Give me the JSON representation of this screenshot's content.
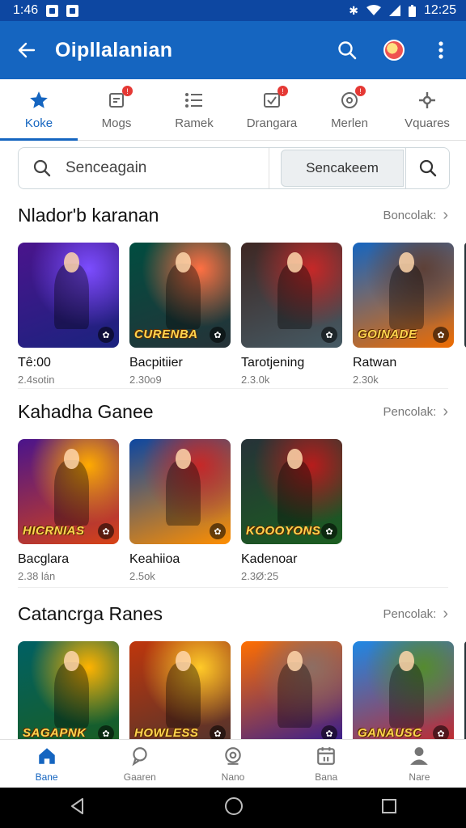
{
  "status": {
    "time": "1:46",
    "right_time": "12:25"
  },
  "app": {
    "title": "Oipllalanian"
  },
  "tabs": [
    {
      "label": "Koke",
      "icon": "star-icon",
      "active": true,
      "badge": false
    },
    {
      "label": "Mogs",
      "icon": "note-icon",
      "active": false,
      "badge": true
    },
    {
      "label": "Ramek",
      "icon": "list-icon",
      "active": false,
      "badge": false
    },
    {
      "label": "Drangara",
      "icon": "checkbox-icon",
      "active": false,
      "badge": true
    },
    {
      "label": "Merlen",
      "icon": "gamepad-icon",
      "active": false,
      "badge": true
    },
    {
      "label": "Vquares",
      "icon": "compass-icon",
      "active": false,
      "badge": false
    }
  ],
  "search": {
    "placeholder": "Senceagain",
    "button_label": "Sencakeem"
  },
  "sections": [
    {
      "title": "Nlador'b karanan",
      "more": "Boncolak:",
      "items": [
        {
          "title": "Tê:00",
          "sub": "2.4sotin",
          "banner": "",
          "colors": [
            "#4a148c",
            "#1a237e",
            "#7c4dff"
          ]
        },
        {
          "title": "Bacpitiier",
          "sub": "2.30o9",
          "banner": "CURENBA",
          "colors": [
            "#004d40",
            "#263238",
            "#ff7043"
          ]
        },
        {
          "title": "Tarotjening",
          "sub": "2.3.0k",
          "banner": "",
          "colors": [
            "#3e2723",
            "#455a64",
            "#c62828"
          ]
        },
        {
          "title": "Ratwan",
          "sub": "2.30k",
          "banner": "GOINADE",
          "colors": [
            "#1565c0",
            "#ef6c00",
            "#5d4037"
          ]
        }
      ]
    },
    {
      "title": "Kahadha Ganee",
      "more": "Pencolak:",
      "items": [
        {
          "title": "Bacglara",
          "sub": "2.38 lán",
          "banner": "HICRNIAS",
          "colors": [
            "#4a148c",
            "#d84315",
            "#ffab00"
          ]
        },
        {
          "title": "Keahiioa",
          "sub": "2.5ok",
          "banner": "",
          "colors": [
            "#0d47a1",
            "#ff8f00",
            "#c62828"
          ]
        },
        {
          "title": "Kadenoar",
          "sub": "2.3Ø:25",
          "banner": "KOOOYONS",
          "colors": [
            "#263238",
            "#1b5e20",
            "#b71c1c"
          ]
        }
      ]
    },
    {
      "title": "Catancrga Ranes",
      "more": "Pencolak:",
      "items": [
        {
          "title": "",
          "sub": "",
          "banner": "SAGAPNK",
          "colors": [
            "#006064",
            "#1b5e20",
            "#ffb300"
          ]
        },
        {
          "title": "",
          "sub": "",
          "banner": "HOWLESS",
          "colors": [
            "#bf360c",
            "#4e342e",
            "#ffca28"
          ]
        },
        {
          "title": "",
          "sub": "",
          "banner": "",
          "colors": [
            "#ff6f00",
            "#311b92",
            "#8d6e63"
          ]
        },
        {
          "title": "",
          "sub": "",
          "banner": "GANAUSC",
          "colors": [
            "#1e88e5",
            "#c62828",
            "#558b2f"
          ]
        }
      ]
    }
  ],
  "bottom_nav": [
    {
      "label": "Bane",
      "icon": "home-icon",
      "active": true
    },
    {
      "label": "Gaaren",
      "icon": "chat-icon",
      "active": false
    },
    {
      "label": "Nano",
      "icon": "search-circle-icon",
      "active": false
    },
    {
      "label": "Bana",
      "icon": "calendar-icon",
      "active": false
    },
    {
      "label": "Nare",
      "icon": "person-icon",
      "active": false
    }
  ],
  "theme": {
    "primary": "#1565c0",
    "primary_dark": "#0d47a1",
    "badge": "#e53935"
  }
}
